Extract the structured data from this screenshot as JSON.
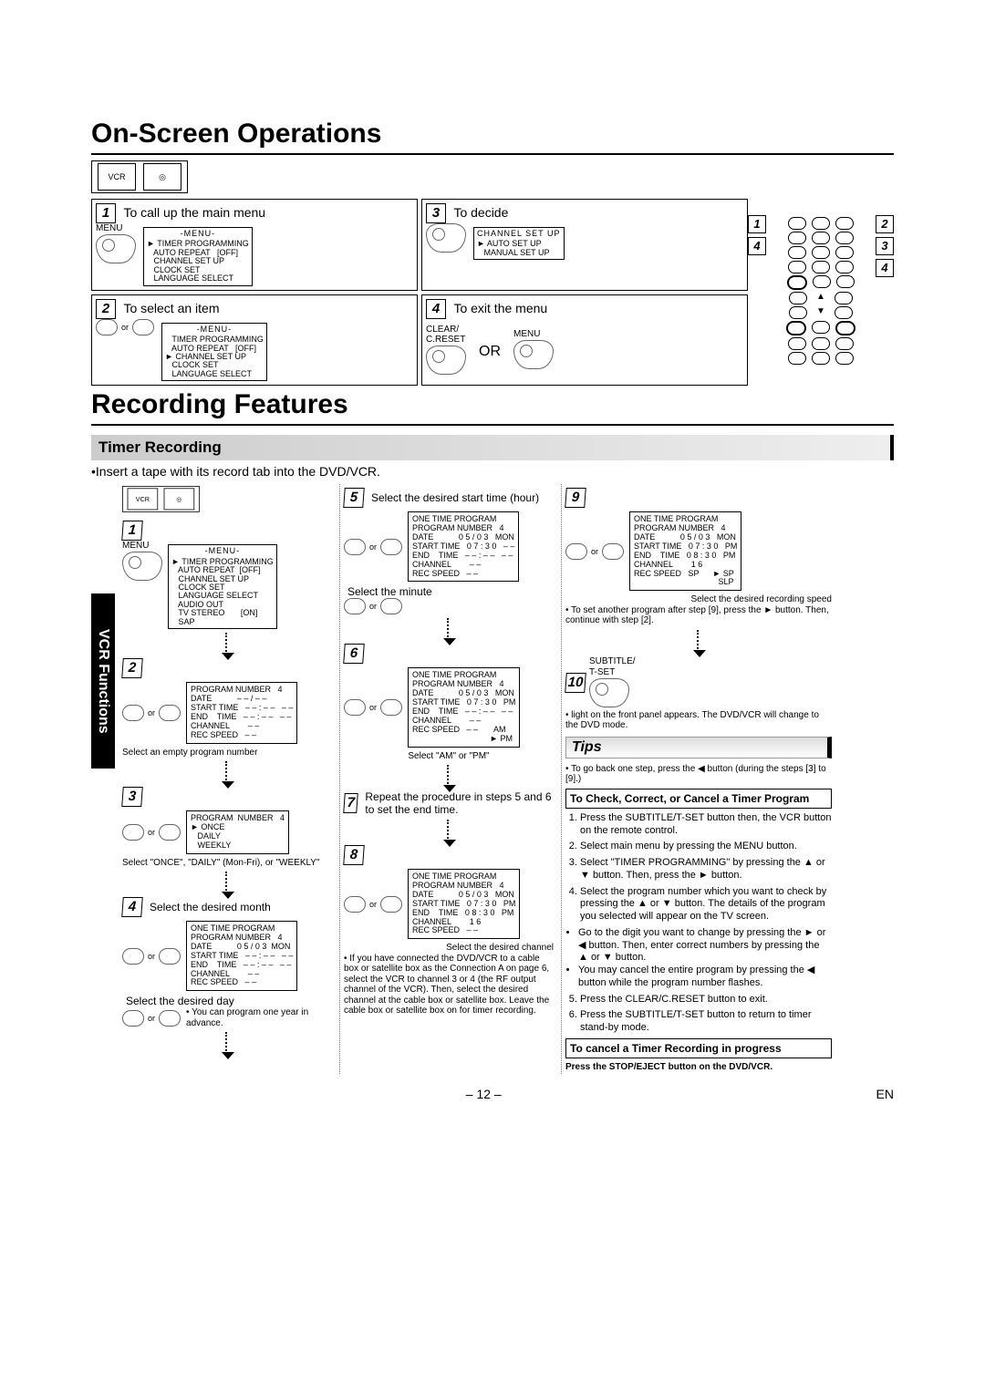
{
  "headings": {
    "onscreen": "On-Screen Operations",
    "recording": "Recording Features",
    "timer": "Timer Recording",
    "tips": "Tips"
  },
  "sidetab": "VCR Functions",
  "onscreen_steps": {
    "s1": {
      "num": "1",
      "label": "To call up the main menu"
    },
    "s2": {
      "num": "2",
      "label": "To select an item"
    },
    "s3": {
      "num": "3",
      "label": "To decide"
    },
    "s4": {
      "num": "4",
      "label": "To exit the menu",
      "or": "OR"
    }
  },
  "menus": {
    "main_title": "-MENU-",
    "main_items": "► TIMER PROGRAMMING\n   AUTO REPEAT   [OFF]\n   CHANNEL SET UP\n   CLOCK SET\n   LANGUAGE SELECT",
    "main_items2": "   TIMER PROGRAMMING\n   AUTO REPEAT   [OFF]\n► CHANNEL SET UP\n   CLOCK SET\n   LANGUAGE SELECT",
    "channel_title": "CHANNEL SET UP",
    "channel_items": "► AUTO SET UP\n   MANUAL SET UP",
    "vcr_menu": "► TIMER PROGRAMMING\n   AUTO REPEAT  [OFF]\n   CHANNEL SET UP\n   CLOCK SET\n   LANGUAGE SELECT\n   AUDIO OUT\n   TV STEREO       [ON]\n   SAP"
  },
  "timer_intro": "•Insert a tape with its record tab into the DVD/VCR.",
  "osd": {
    "prog_blank": "PROGRAM NUMBER   4\nDATE           – – / – –\nSTART TIME   – – : – –   – –\nEND    TIME   – – : – –   – –\nCHANNEL        – –\nREC SPEED   – –",
    "prog_once": "PROGRAM  NUMBER   4\n► ONCE\n   DAILY\n   WEEKLY",
    "otp_header": "ONE TIME PROGRAM",
    "otp_month": "PROGRAM NUMBER   4\nDATE           0 5 / 0 3  MON\nSTART TIME   – – : – –   – –\nEND    TIME   – – : – –   – –\nCHANNEL        – –\nREC SPEED   – –",
    "otp_start": "PROGRAM NUMBER   4\nDATE           0 5 / 0 3   MON\nSTART TIME   0 7 : 3 0   – –\nEND    TIME   – – : – –   – –\nCHANNEL        – –\nREC SPEED   – –",
    "otp_ampm": "PROGRAM NUMBER   4\nDATE           0 5 / 0 3   MON\nSTART TIME   0 7 : 3 0   PM\nEND    TIME   – – : – –   – –\nCHANNEL        – –\nREC SPEED   – –       AM\n                                  ► PM",
    "otp_end": "PROGRAM NUMBER   4\nDATE           0 5 / 0 3   MON\nSTART TIME   0 7 : 3 0   PM\nEND    TIME   0 8 : 3 0   PM\nCHANNEL        1 6\nREC SPEED   – –",
    "otp_speed": "PROGRAM NUMBER   4\nDATE           0 5 / 0 3   MON\nSTART TIME   0 7 : 3 0   PM\nEND    TIME   0 8 : 3 0   PM\nCHANNEL        1 6\nREC SPEED   SP      ► SP\n                                     SLP"
  },
  "captions": {
    "c2": "Select an empty program number",
    "c3": "Select \"ONCE\", \"DAILY\" (Mon-Fri), or \"WEEKLY\"",
    "c4a": "Select the desired month",
    "c4b": "Select the desired day",
    "c4note": "• You can program one year in advance.",
    "c5a": "Select the desired start time (hour)",
    "c5b": "Select the minute",
    "c6": "Select \"AM\" or \"PM\"",
    "c7": "Repeat the procedure in steps 5 and 6 to set the end time.",
    "c8a": "Select the desired channel",
    "c8b": "• If you have connected the DVD/VCR to a cable box or satellite box as the Connection A on page 6, select the VCR to channel 3 or 4 (the RF output channel of the VCR). Then, select the desired channel at the cable box or satellite box. Leave the cable box or satellite box on for timer recording.",
    "c9a": "Select the desired recording speed",
    "c9b": "• To set another program after step [9], press the ► button. Then, continue with step [2].",
    "c10": "•      light on the front panel appears. The DVD/VCR will change to the DVD mode."
  },
  "tips": {
    "t0": "• To go back one step, press the ◀ button (during the steps [3] to [9].)",
    "box1": "To Check, Correct, or Cancel a Timer Program",
    "list": [
      "Press the SUBTITLE/T-SET button then, the VCR button on the remote control.",
      "Select main menu by pressing the MENU button.",
      "Select \"TIMER PROGRAMMING\" by pressing the ▲ or ▼ button. Then, press the ► button.",
      "Select the program number which you want to check by pressing the ▲ or ▼ button. The details of the program you selected will appear on the TV screen."
    ],
    "bullets": [
      "Go to the digit you want to change by pressing the ► or ◀ button. Then, enter correct numbers by pressing the ▲ or ▼ button.",
      "You may cancel the entire program by pressing the ◀ button while the program number flashes."
    ],
    "list2": [
      "Press the CLEAR/C.RESET button to exit.",
      "Press the SUBTITLE/T-SET button to return to timer stand-by mode."
    ],
    "box2": "To cancel a Timer Recording in progress",
    "final": "Press the STOP/EJECT button on the DVD/VCR."
  },
  "labels": {
    "menu_btn": "MENU",
    "clear_btn": "CLEAR/\nC.RESET",
    "subtitle_btn": "SUBTITLE/\nT-SET",
    "or": "or",
    "vcr": "VCR"
  },
  "footer": {
    "page": "– 12 –",
    "lang": "EN"
  }
}
